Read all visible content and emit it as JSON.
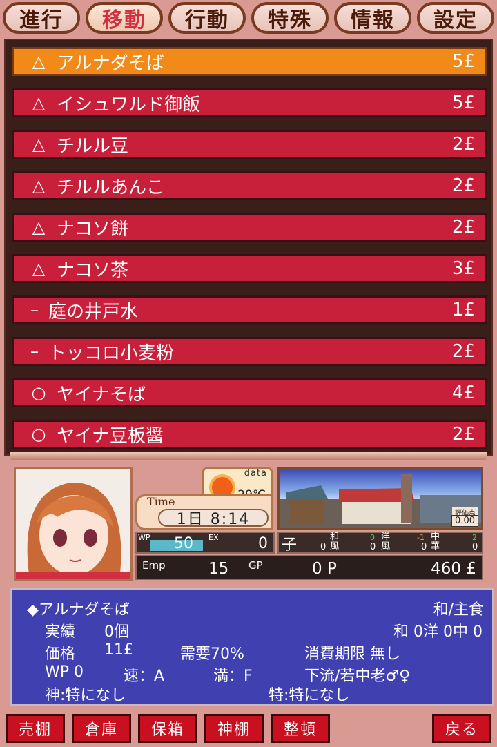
{
  "tabs": [
    "進行",
    "移動",
    "行動",
    "特殊",
    "情報",
    "設定"
  ],
  "active_tab_index": 1,
  "items": [
    {
      "mark": "△",
      "name": "アルナダそば",
      "price": "5£",
      "selected": true
    },
    {
      "mark": "△",
      "name": "イシュワルド御飯",
      "price": "5£"
    },
    {
      "mark": "△",
      "name": "チルル豆",
      "price": "2£"
    },
    {
      "mark": "△",
      "name": "チルルあんこ",
      "price": "2£"
    },
    {
      "mark": "△",
      "name": "ナコソ餅",
      "price": "2£"
    },
    {
      "mark": "△",
      "name": "ナコソ茶",
      "price": "3£"
    },
    {
      "mark": "–",
      "name": "庭の井戸水",
      "price": "1£"
    },
    {
      "mark": "–",
      "name": "トッコロ小麦粉",
      "price": "2£"
    },
    {
      "mark": "○",
      "name": "ヤイナそば",
      "price": "4£"
    },
    {
      "mark": "○",
      "name": "ヤイナ豆板醤",
      "price": "2£"
    }
  ],
  "weather": {
    "label": "data",
    "icon": "sun-icon",
    "temp": "29℃"
  },
  "time": {
    "label": "Time",
    "value": "1日 8:14"
  },
  "scene": {
    "eval_label": "評価点",
    "eval_value": "0.00"
  },
  "stats": {
    "wp_label": "WP",
    "wp_value": "50",
    "wp_fill": 1.0,
    "ex_label": "EX",
    "ex_value": "0",
    "emp_label": "Emp",
    "emp_value": "15",
    "gp_label": "GP",
    "gp_value": "0 P",
    "money": "460 £"
  },
  "kanji": [
    {
      "char": "子",
      "value": "0",
      "sup": ""
    },
    {
      "char": "和風",
      "value": "0",
      "sup": "0"
    },
    {
      "char": "洋風",
      "value": "0",
      "sup": "-1"
    },
    {
      "char": "中華",
      "value": "0",
      "sup": "2"
    }
  ],
  "detail": {
    "name": "◆アルナダそば",
    "category": "和/主食",
    "record_label": "実績",
    "record_value": "0個",
    "cuisine_counts": "和 0洋 0中 0",
    "price_label": "価格",
    "price_value": "11£",
    "demand": "需要70%",
    "expiry": "消費期限 無し",
    "wp": "WP 0",
    "speed": "速：A",
    "fullness": "満：F",
    "target": "下流/若中老♂♀",
    "god": "神:特になし",
    "special": "特:特になし"
  },
  "buttons": [
    "売棚",
    "倉庫",
    "保箱",
    "神棚",
    "整頓"
  ],
  "back_button": "戻る",
  "colors": {
    "row": "#c8203a",
    "row_selected": "#f28a1a",
    "detail_bg": "#4040b0",
    "button": "#c81020"
  }
}
